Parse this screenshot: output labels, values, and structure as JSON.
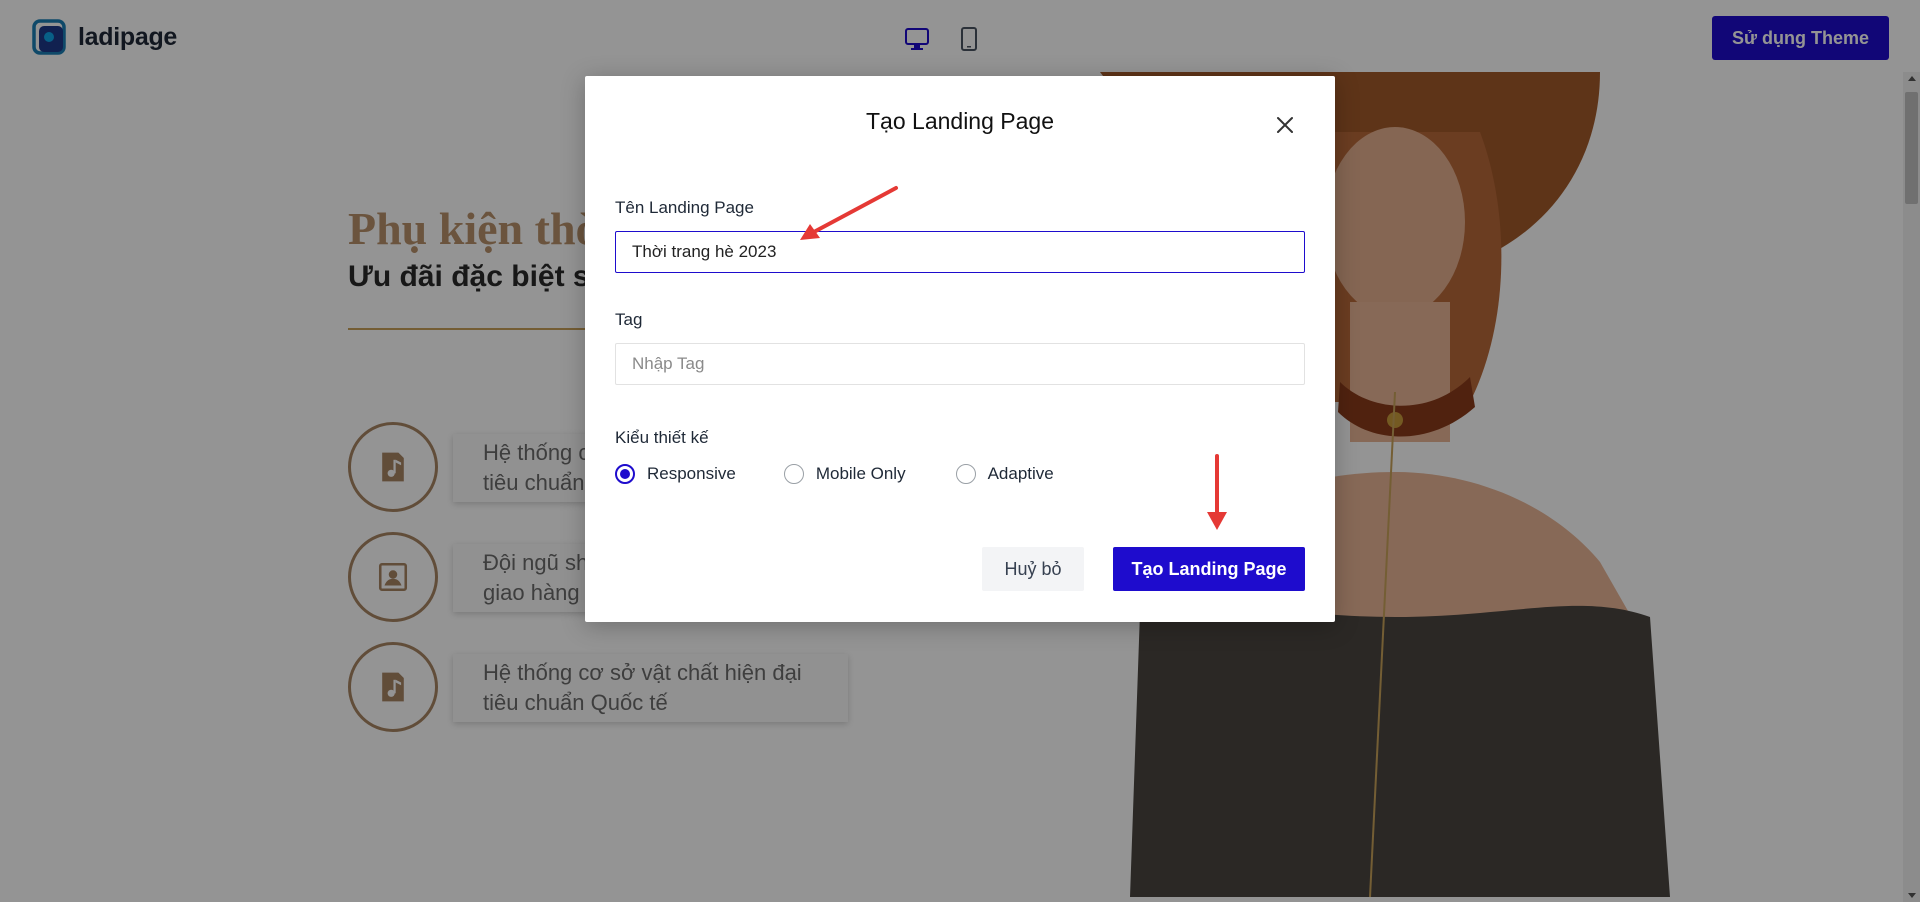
{
  "app": {
    "logo_text": "ladipage",
    "use_theme_label": "Sử dụng Theme"
  },
  "preview": {
    "hero_title": "Phụ kiện thời trang",
    "hero_subtitle": "Ưu đãi đặc biệt sắp đến",
    "features": [
      {
        "text": "Hệ thống cơ sở vật chất hiện đại tiêu chuẩn Quốc tế",
        "icon": "music-book-icon"
      },
      {
        "text": "Đội ngũ shipper chuyên nghiệp giao hàng chóng chính xác",
        "icon": "portrait-icon"
      },
      {
        "text": "Hệ thống cơ sở vật chất hiện đại tiêu chuẩn Quốc tế",
        "icon": "music-book-icon"
      }
    ]
  },
  "modal": {
    "title": "Tạo Landing Page",
    "name_label": "Tên Landing Page",
    "name_value": "Thời trang hè 2023",
    "tag_label": "Tag",
    "tag_placeholder": "Nhập Tag",
    "design_label": "Kiểu thiết kế",
    "options": [
      {
        "label": "Responsive",
        "checked": true
      },
      {
        "label": "Mobile Only",
        "checked": false
      },
      {
        "label": "Adaptive",
        "checked": false
      }
    ],
    "cancel_label": "Huỷ bỏ",
    "create_label": "Tạo Landing Page"
  },
  "colors": {
    "accent": "#1e0ccd",
    "annotation_arrow": "#e53935",
    "hero_title": "#b8926c"
  }
}
